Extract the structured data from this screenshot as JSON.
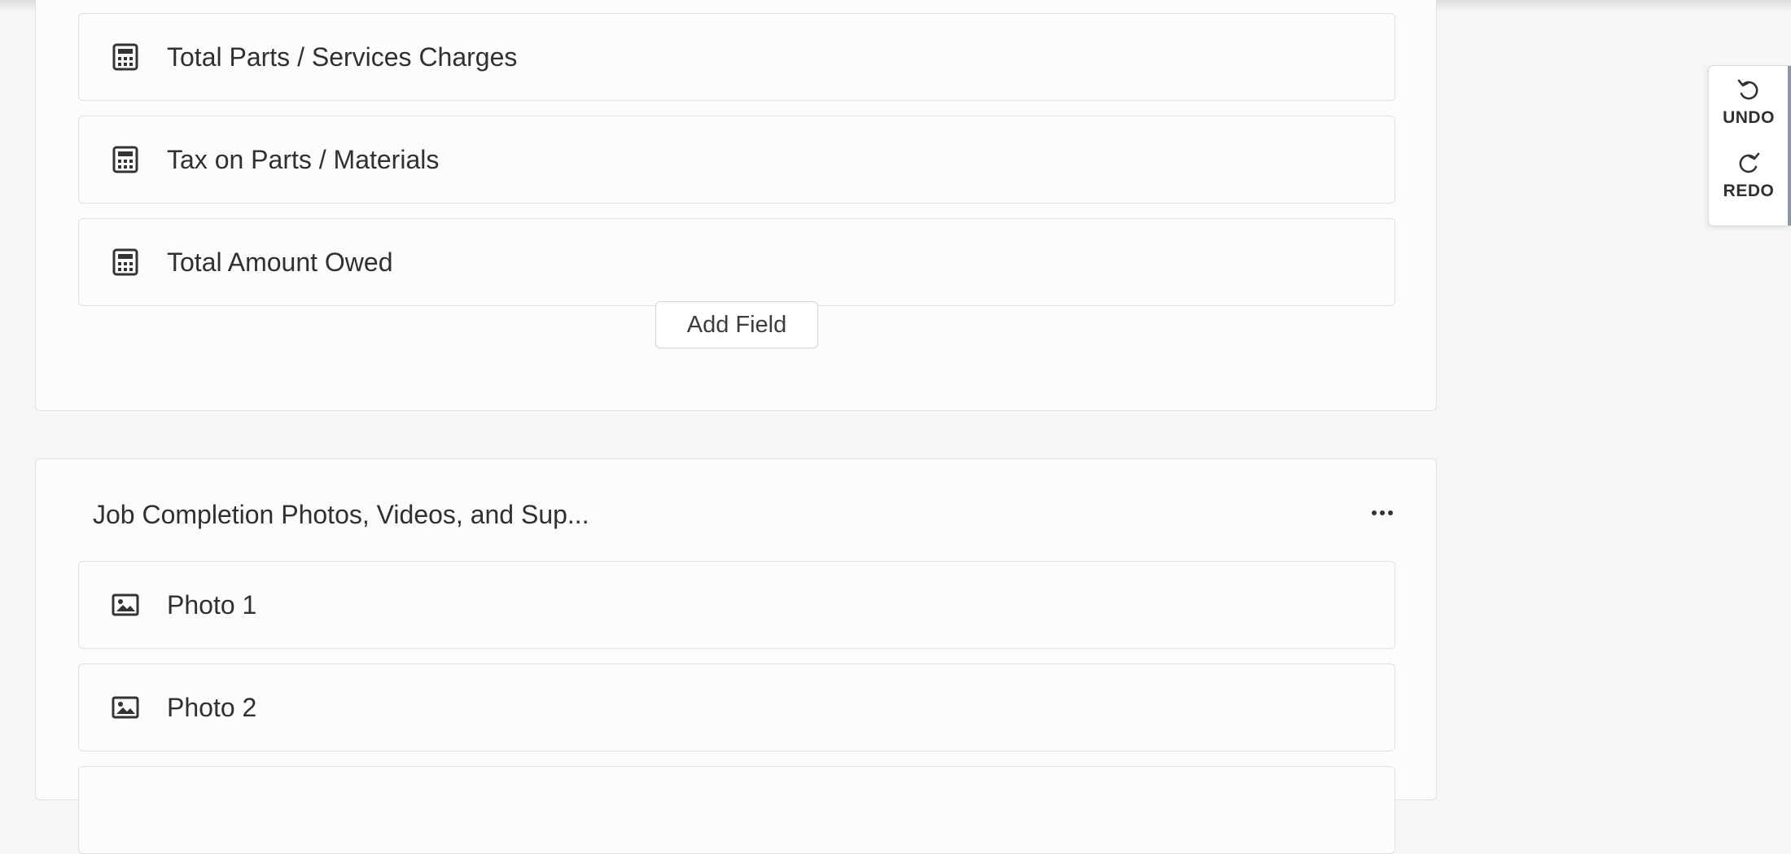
{
  "sections": [
    {
      "fields": [
        {
          "label": "Total Parts / Services Charges",
          "icon": "calculator-icon"
        },
        {
          "label": "Tax on Parts / Materials",
          "icon": "calculator-icon"
        },
        {
          "label": "Total Amount Owed",
          "icon": "calculator-icon"
        }
      ],
      "add_field_label": "Add Field"
    },
    {
      "title": "Job Completion Photos, Videos, and Sup...",
      "more_icon": "more-horizontal-icon",
      "fields": [
        {
          "label": "Photo 1",
          "icon": "image-icon"
        },
        {
          "label": "Photo 2",
          "icon": "image-icon"
        }
      ]
    }
  ],
  "history": {
    "undo_label": "UNDO",
    "redo_label": "REDO",
    "accent_color": "#8a96aa"
  }
}
